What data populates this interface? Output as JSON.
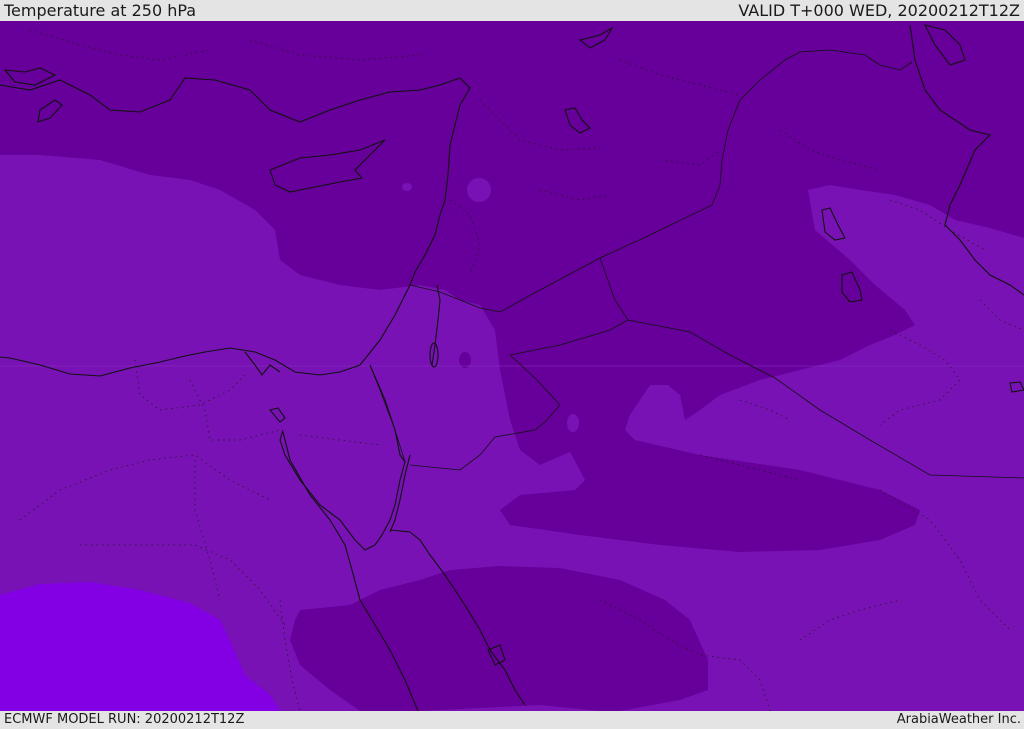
{
  "header": {
    "title": "Temperature at 250 hPa",
    "valid": "VALID T+000 WED, 20200212T12Z"
  },
  "footer": {
    "model_run": "ECMWF MODEL RUN: 20200212T12Z",
    "credit": "ArabiaWeather Inc."
  },
  "colors": {
    "band_cold": "#67009a",
    "band_mid": "#7812b5",
    "band_warm": "#8300e4",
    "coastline": "#111111",
    "bar_bg": "#e4e4e4"
  }
}
